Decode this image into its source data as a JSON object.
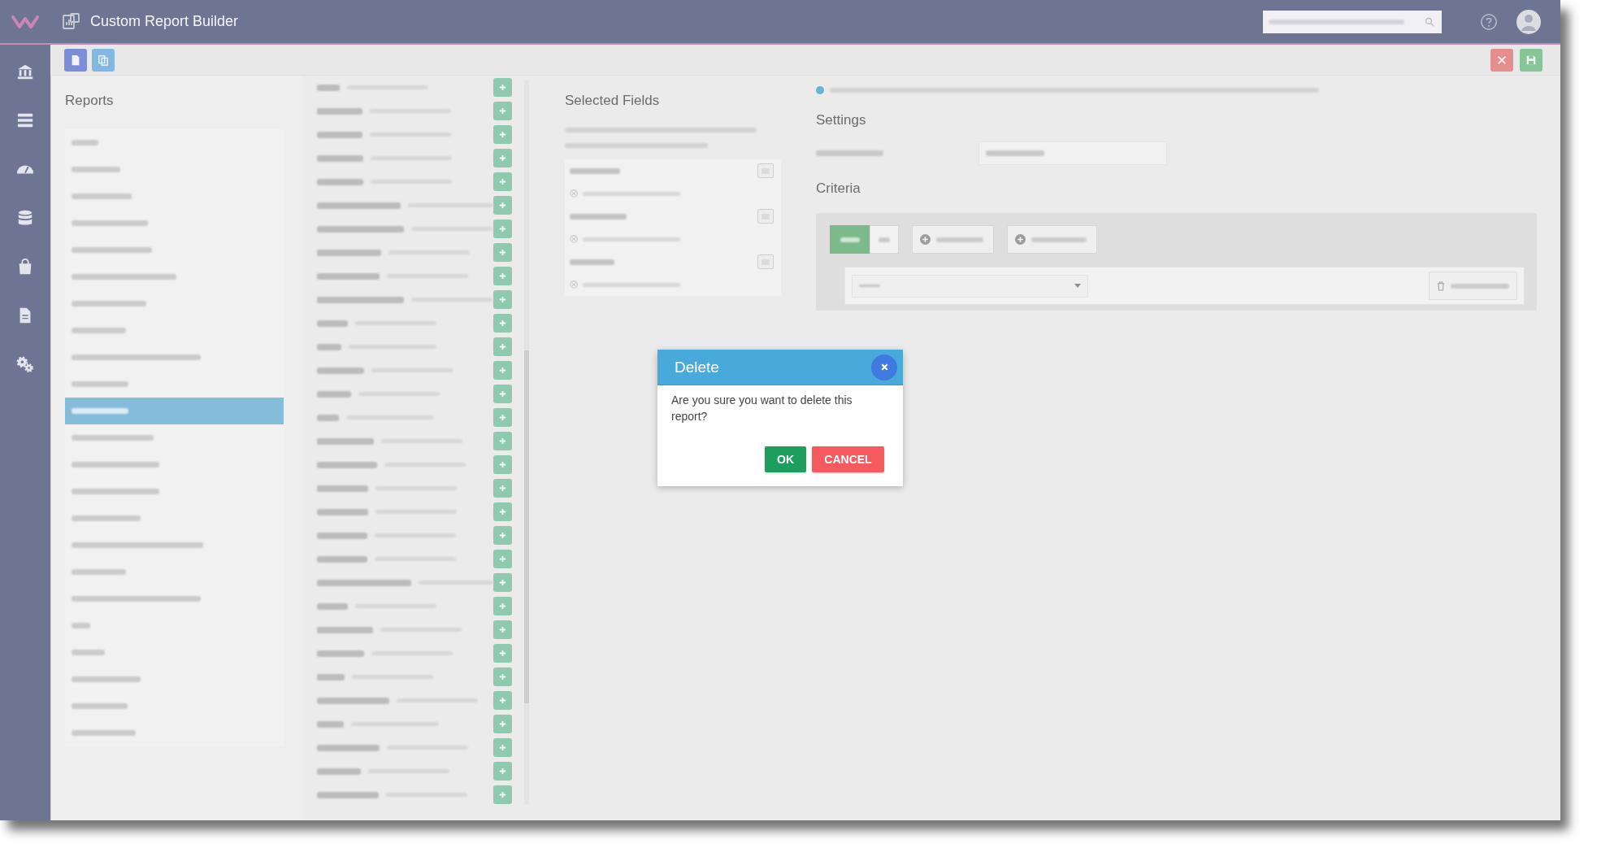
{
  "header": {
    "title": "Custom Report Builder"
  },
  "reports": {
    "title": "Reports",
    "items": [
      {
        "selected": false
      },
      {
        "selected": false
      },
      {
        "selected": false
      },
      {
        "selected": false
      },
      {
        "selected": false
      },
      {
        "selected": false
      },
      {
        "selected": false
      },
      {
        "selected": false
      },
      {
        "selected": false
      },
      {
        "selected": false
      },
      {
        "selected": true
      },
      {
        "selected": false
      },
      {
        "selected": false
      },
      {
        "selected": false
      },
      {
        "selected": false
      },
      {
        "selected": false
      },
      {
        "selected": false
      },
      {
        "selected": false
      },
      {
        "selected": false
      },
      {
        "selected": false
      },
      {
        "selected": false
      },
      {
        "selected": false
      },
      {
        "selected": false
      }
    ]
  },
  "selected_fields": {
    "title": "Selected Fields"
  },
  "settings": {
    "title": "Settings"
  },
  "criteria": {
    "title": "Criteria",
    "conditions": [
      {
        "selected": true
      },
      {
        "selected": false
      }
    ]
  },
  "dialog": {
    "title": "Delete",
    "message": "Are you sure you want to delete this report?",
    "buttons": [
      {
        "label": "OK",
        "kind": "confirm"
      },
      {
        "label": "CANCEL",
        "kind": "cancel"
      }
    ]
  }
}
